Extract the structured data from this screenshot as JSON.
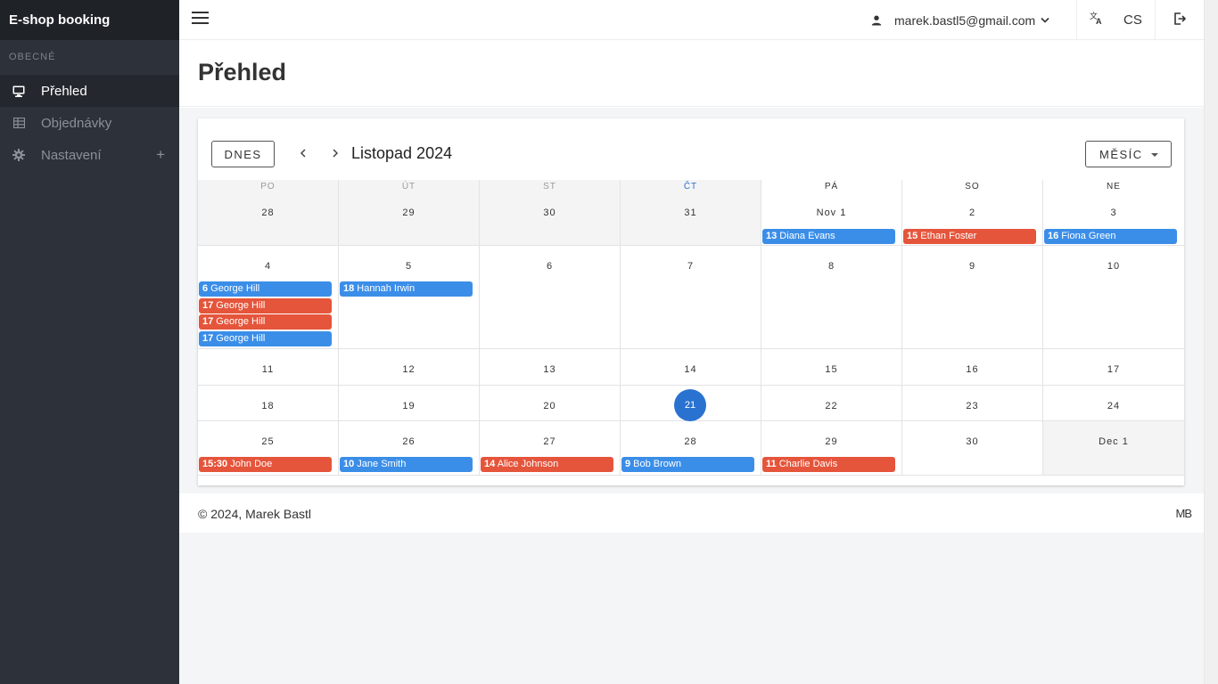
{
  "app": {
    "brand": "E-shop booking"
  },
  "sidebar": {
    "section": "OBECNÉ",
    "items": [
      {
        "label": "Přehled",
        "icon": "monitor-icon",
        "active": true
      },
      {
        "label": "Objednávky",
        "icon": "table-icon"
      },
      {
        "label": "Nastavení",
        "icon": "gear-icon",
        "expandable": true
      }
    ],
    "expand_glyph": "+"
  },
  "header": {
    "user_email": "marek.bastl5@gmail.com",
    "language": "CS"
  },
  "page": {
    "title": "Přehled"
  },
  "calendar": {
    "today_button": "DNES",
    "prev_glyph": "‹",
    "next_glyph": "›",
    "month_title": "Listopad 2024",
    "view_button": "MĚSÍC",
    "weekdays": [
      "PO",
      "ÚT",
      "ST",
      "ČT",
      "PÁ",
      "SO",
      "NE"
    ],
    "today": "21",
    "weeks": [
      [
        "28",
        "29",
        "30",
        "31",
        "Nov 1",
        "2",
        "3"
      ],
      [
        "4",
        "5",
        "6",
        "7",
        "8",
        "9",
        "10"
      ],
      [
        "11",
        "12",
        "13",
        "14",
        "15",
        "16",
        "17"
      ],
      [
        "18",
        "19",
        "20",
        "21",
        "22",
        "23",
        "24"
      ],
      [
        "25",
        "26",
        "27",
        "28",
        "29",
        "30",
        "Dec 1"
      ]
    ],
    "events": [
      {
        "week": 0,
        "day": 4,
        "row": 0,
        "time": "13",
        "name": "Diana Evans",
        "color": "blue"
      },
      {
        "week": 0,
        "day": 5,
        "row": 0,
        "time": "15",
        "name": "Ethan Foster",
        "color": "red"
      },
      {
        "week": 0,
        "day": 6,
        "row": 0,
        "time": "16",
        "name": "Fiona Green",
        "color": "blue"
      },
      {
        "week": 1,
        "day": 0,
        "row": 0,
        "time": "6",
        "name": "George Hill",
        "color": "blue"
      },
      {
        "week": 1,
        "day": 0,
        "row": 1,
        "time": "17",
        "name": "George Hill",
        "color": "red"
      },
      {
        "week": 1,
        "day": 0,
        "row": 2,
        "time": "17",
        "name": "George Hill",
        "color": "red"
      },
      {
        "week": 1,
        "day": 0,
        "row": 3,
        "time": "17",
        "name": "George Hill",
        "color": "blue"
      },
      {
        "week": 1,
        "day": 1,
        "row": 0,
        "time": "18",
        "name": "Hannah Irwin",
        "color": "blue"
      },
      {
        "week": 4,
        "day": 0,
        "row": 0,
        "time": "15:30",
        "name": "John Doe",
        "color": "red"
      },
      {
        "week": 4,
        "day": 1,
        "row": 0,
        "time": "10",
        "name": "Jane Smith",
        "color": "blue"
      },
      {
        "week": 4,
        "day": 2,
        "row": 0,
        "time": "14",
        "name": "Alice Johnson",
        "color": "red"
      },
      {
        "week": 4,
        "day": 3,
        "row": 0,
        "time": "9",
        "name": "Bob Brown",
        "color": "blue"
      },
      {
        "week": 4,
        "day": 4,
        "row": 0,
        "time": "11",
        "name": "Charlie Davis",
        "color": "red"
      }
    ]
  },
  "footer": {
    "copyright": "© 2024, Marek Bastl",
    "logo_text": "MB"
  },
  "colors": {
    "event_blue": "#3b8ee8",
    "event_red": "#e5553b",
    "today": "#2a72d0",
    "sidebar": "#2d3139"
  }
}
